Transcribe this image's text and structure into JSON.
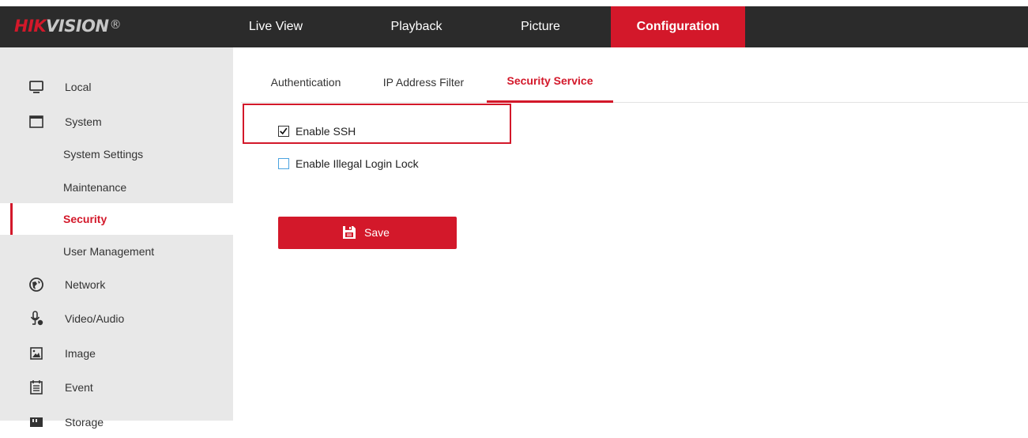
{
  "brand": {
    "logo_hik": "HIK",
    "logo_vision": "VISION",
    "logo_reg": "®"
  },
  "nav": {
    "items": [
      {
        "label": "Live View"
      },
      {
        "label": "Playback"
      },
      {
        "label": "Picture"
      },
      {
        "label": "Configuration",
        "active": true
      }
    ]
  },
  "sidebar": {
    "items": [
      {
        "label": "Local",
        "icon": "monitor-icon"
      },
      {
        "label": "System",
        "icon": "window-icon"
      },
      {
        "label": "System Settings"
      },
      {
        "label": "Maintenance"
      },
      {
        "label": "Security",
        "active": true
      },
      {
        "label": "User Management"
      },
      {
        "label": "Network",
        "icon": "globe-icon"
      },
      {
        "label": "Video/Audio",
        "icon": "microphone-icon"
      },
      {
        "label": "Image",
        "icon": "image-icon"
      },
      {
        "label": "Event",
        "icon": "calendar-icon"
      },
      {
        "label": "Storage",
        "icon": "storage-icon"
      }
    ]
  },
  "tabs": [
    {
      "label": "Authentication"
    },
    {
      "label": "IP Address Filter"
    },
    {
      "label": "Security Service",
      "active": true
    }
  ],
  "form": {
    "enable_ssh": {
      "label": "Enable SSH",
      "checked": true
    },
    "illegal_login_lock": {
      "label": "Enable Illegal Login Lock",
      "checked": false
    },
    "save_label": "Save"
  },
  "colors": {
    "accent": "#d3182a",
    "topbar": "#2b2b2b",
    "sidebar": "#e8e8e8",
    "checkbox_border_inactive": "#4ba3e0"
  }
}
